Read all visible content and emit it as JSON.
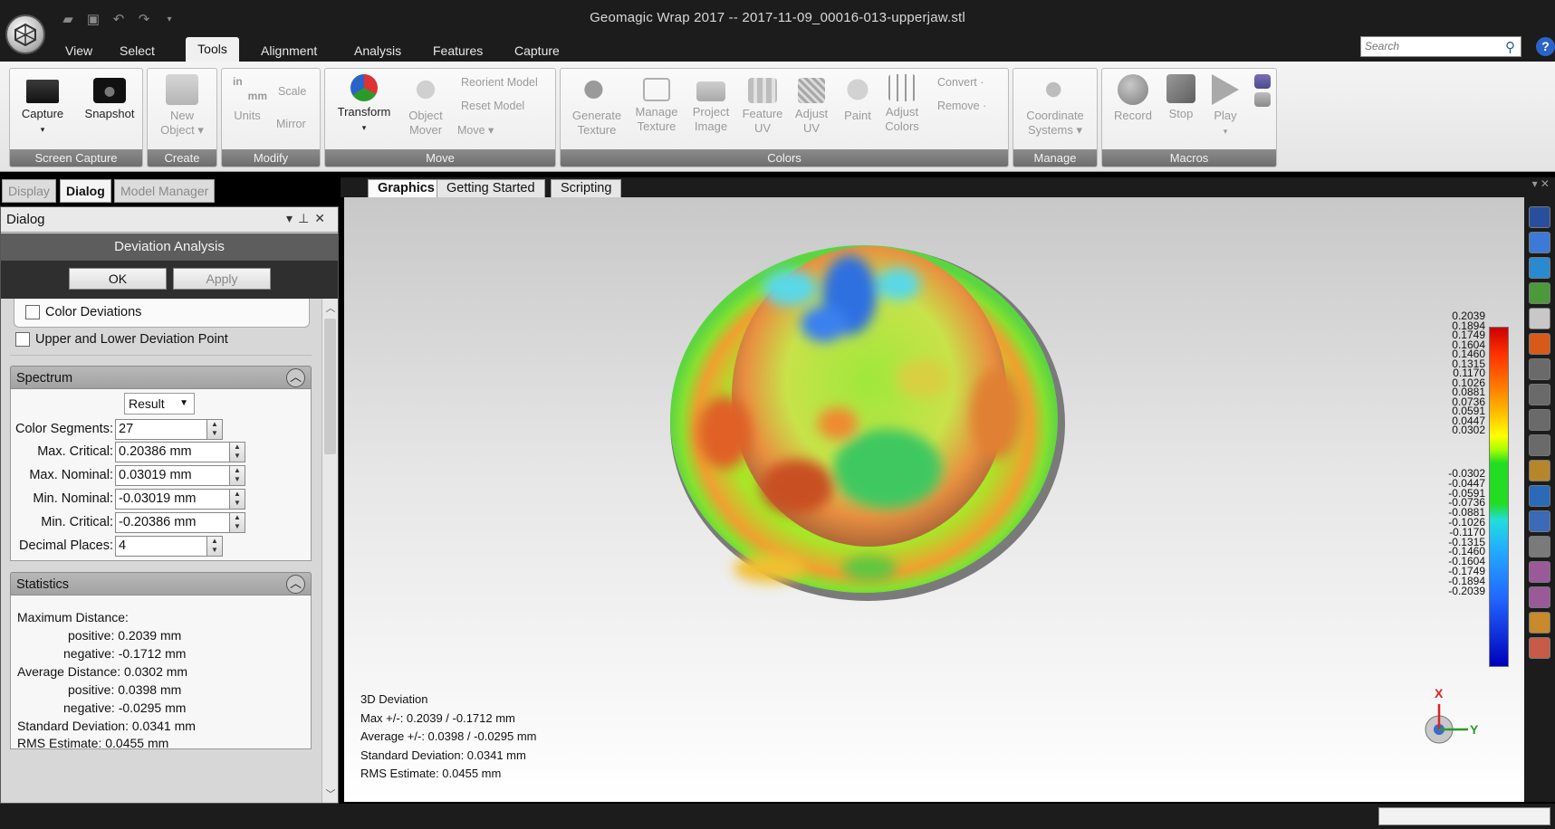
{
  "window": {
    "title": "Geomagic Wrap 2017 -- 2017-11-09_00016-013-upperjaw.stl"
  },
  "menu_tabs": [
    "View",
    "Select",
    "Tools",
    "Alignment",
    "Analysis",
    "Features",
    "Capture"
  ],
  "active_menu_tab": "Tools",
  "search": {
    "placeholder": "Search"
  },
  "ribbon": {
    "screen_capture": {
      "label": "Screen Capture",
      "capture": "Capture",
      "snapshot": "Snapshot"
    },
    "create": {
      "label": "Create",
      "new_object_1": "New",
      "new_object_2": "Object"
    },
    "modify": {
      "label": "Modify",
      "in": "in",
      "mm": "mm",
      "units": "Units",
      "scale": "Scale",
      "mirror": "Mirror"
    },
    "move": {
      "label": "Move",
      "transform": "Transform",
      "object_mover_1": "Object",
      "object_mover_2": "Mover",
      "reorient_model": "Reorient Model",
      "reset_model": "Reset Model",
      "move": "Move"
    },
    "colors": {
      "label": "Colors",
      "generate_texture_1": "Generate",
      "generate_texture_2": "Texture",
      "manage_texture_1": "Manage",
      "manage_texture_2": "Texture",
      "project_image_1": "Project",
      "project_image_2": "Image",
      "feature_uv_1": "Feature",
      "feature_uv_2": "UV",
      "adjust_uv_1": "Adjust",
      "adjust_uv_2": "UV",
      "paint": "Paint",
      "adjust_colors_1": "Adjust",
      "adjust_colors_2": "Colors",
      "convert": "Convert",
      "remove": "Remove"
    },
    "manage": {
      "label": "Manage",
      "coord_1": "Coordinate",
      "coord_2": "Systems"
    },
    "macros": {
      "label": "Macros",
      "record": "Record",
      "stop": "Stop",
      "play": "Play"
    }
  },
  "panel_tabs": [
    "Display",
    "Dialog",
    "Model Manager"
  ],
  "dialog": {
    "header": "Dialog",
    "title": "Deviation Analysis",
    "ok": "OK",
    "apply": "Apply",
    "color_deviations": "Color Deviations",
    "upper_lower": "Upper and Lower Deviation Point",
    "spectrum": {
      "title": "Spectrum",
      "mode": "Result",
      "fields": [
        {
          "label": "Color Segments:",
          "value": "27"
        },
        {
          "label": "Max. Critical:",
          "value": "0.20386 mm"
        },
        {
          "label": "Max. Nominal:",
          "value": "0.03019 mm"
        },
        {
          "label": "Min. Nominal:",
          "value": "-0.03019 mm"
        },
        {
          "label": "Min. Critical:",
          "value": "-0.20386 mm"
        },
        {
          "label": "Decimal Places:",
          "value": "4"
        }
      ]
    },
    "statistics": {
      "title": "Statistics",
      "lines": [
        "Maximum Distance:",
        "positive: 0.2039 mm",
        "negative: -0.1712 mm",
        "Average Distance: 0.0302 mm",
        "positive: 0.0398 mm",
        "negative: -0.0295 mm",
        "Standard Deviation: 0.0341 mm",
        "RMS Estimate: 0.0455 mm"
      ]
    }
  },
  "graphics_tabs": [
    "Graphics",
    "Getting Started",
    "Scripting"
  ],
  "viewport": {
    "overlay": [
      "3D Deviation",
      "Max +/-: 0.2039 / -0.1712 mm",
      "Average +/-: 0.0398 / -0.0295 mm",
      "Standard Deviation: 0.0341 mm",
      "RMS Estimate: 0.0455 mm"
    ],
    "legend_positive": [
      "0.2039",
      "0.1894",
      "0.1749",
      "0.1604",
      "0.1460",
      "0.1315",
      "0.1170",
      "0.1026",
      "0.0881",
      "0.0736",
      "0.0591",
      "0.0447",
      "0.0302"
    ],
    "legend_negative": [
      "-0.0302",
      "-0.0447",
      "-0.0591",
      "-0.0736",
      "-0.0881",
      "-0.1026",
      "-0.1170",
      "-0.1315",
      "-0.1460",
      "-0.1604",
      "-0.1749",
      "-0.1894",
      "-0.2039"
    ],
    "axis_x": "X",
    "axis_y": "Y"
  },
  "colors": {
    "spectrum_high": "#cc0000",
    "spectrum_nominal": "#22dd22",
    "spectrum_low": "#0000bb",
    "help_blue": "#2b63c9"
  }
}
